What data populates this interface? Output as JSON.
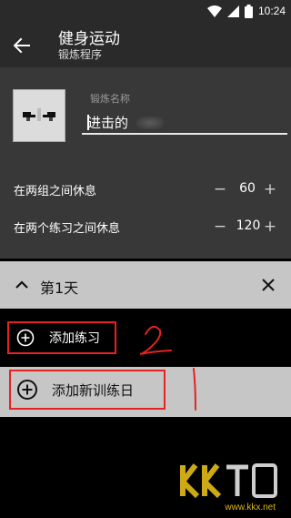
{
  "status_bar": {
    "time": "10:24",
    "icons": [
      "wifi-icon",
      "signal-icon",
      "battery-icon"
    ]
  },
  "app_bar": {
    "title": "健身运动",
    "subtitle": "锻炼程序",
    "back_icon": "arrow-left-icon"
  },
  "program": {
    "name_label": "锻炼名称",
    "name_value": "进击的",
    "rest_between_sets": {
      "label": "在两组之间休息",
      "value": "60",
      "minus": "−",
      "plus": "+"
    },
    "rest_between_exercises": {
      "label": "在两个练习之间休息",
      "value": "120",
      "minus": "−",
      "plus": "+"
    }
  },
  "day": {
    "label": "第1天",
    "chevron_icon": "chevron-up-icon",
    "close_icon": "close-icon"
  },
  "actions": {
    "add_exercise": "添加练习",
    "add_training_day": "添加新训练日"
  },
  "watermark": {
    "text": "www.kkx.net"
  },
  "colors": {
    "appbar": "#2a2a2a",
    "panel": "#383838",
    "day_bar": "#c6c6c6",
    "annotation": "#e52222",
    "watermark": "#ffd31a"
  }
}
